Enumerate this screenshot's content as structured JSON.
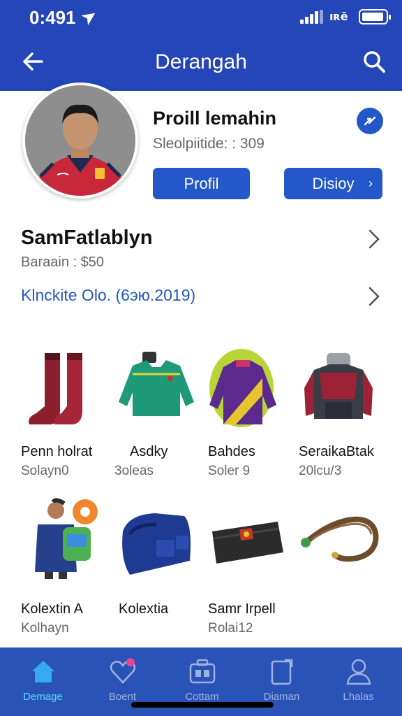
{
  "status_bar": {
    "time": "0:491",
    "wifi_text": "⠇⠘⠘"
  },
  "app_bar": {
    "title": "Derangah"
  },
  "profile": {
    "name": "Proill lemahin",
    "subtitle": "Sleolpiitide: : 309",
    "primary_button": "Profil",
    "secondary_button": "Disioy"
  },
  "rows": [
    {
      "title": "SamFatlablyn",
      "subtitle": "Baraain : $50"
    },
    {
      "title": "Klnckite  Olo.  (6эю.2019)"
    }
  ],
  "items": [
    {
      "name": "Penn holrat",
      "price": "Solayn0",
      "icon": "red-boots-icon"
    },
    {
      "name": "Asdky",
      "price": "3oleas",
      "icon": "green-jersey-icon"
    },
    {
      "name": "Bahdes",
      "price": "Soler 9",
      "icon": "purple-jersey-icon"
    },
    {
      "name": "SeraikaBtak",
      "price": "20lcu/3",
      "icon": "armor-icon"
    },
    {
      "name": "Kolextin A",
      "price": "Kolhayn",
      "icon": "avatar-backpack-icon"
    },
    {
      "name": "Kolextia",
      "price": "",
      "icon": "blue-bag-icon"
    },
    {
      "name": "Samr Irpell",
      "price": "Rolai12",
      "icon": "wallet-icon"
    },
    {
      "name": "",
      "price": "",
      "icon": "leather-strap-icon"
    }
  ],
  "bottom_nav": [
    {
      "label": "Demage",
      "icon": "home-icon",
      "active": true
    },
    {
      "label": "Boent",
      "icon": "heart-icon",
      "active": false
    },
    {
      "label": "Cottam",
      "icon": "toolbox-icon",
      "active": false
    },
    {
      "label": "Diaman",
      "icon": "clipboard-icon",
      "active": false
    },
    {
      "label": "Lhalas",
      "icon": "profile-icon",
      "active": false
    }
  ],
  "colors": {
    "brand": "#2446b8",
    "accent": "#2457c9",
    "nav_active": "#5ad8ff"
  }
}
